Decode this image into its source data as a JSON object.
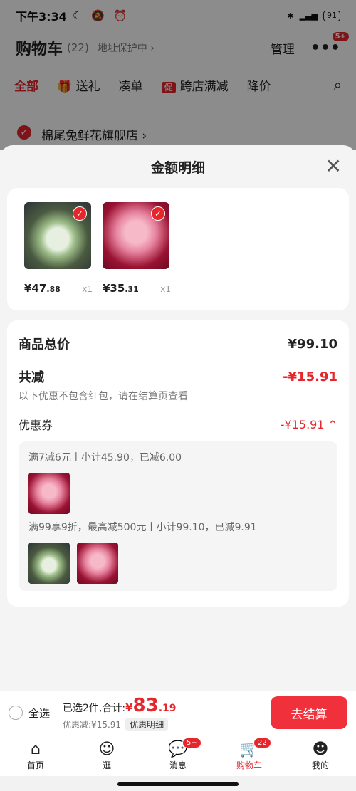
{
  "status_bar": {
    "time": "下午3:34",
    "battery": "91"
  },
  "cart_header": {
    "title": "购物车",
    "count": "(22)",
    "address_protect": "地址保护中 ›",
    "manage": "管理",
    "more_badge": "5+"
  },
  "filter_tabs": [
    {
      "label": "全部"
    },
    {
      "label": "送礼"
    },
    {
      "label": "凑单"
    },
    {
      "label": "跨店满减",
      "tag": "促"
    },
    {
      "label": "降价"
    }
  ],
  "store": {
    "name": "棉尾兔鲜花旗舰店 ›"
  },
  "sheet": {
    "title": "金额明细"
  },
  "products": [
    {
      "price_int": "¥47",
      "price_dec": ".88",
      "qty": "x1"
    },
    {
      "price_int": "¥35",
      "price_dec": ".31",
      "qty": "x1"
    }
  ],
  "details": {
    "goods_total_label": "商品总价",
    "goods_total_value": "¥99.10",
    "discount_label": "共减",
    "discount_value": "-¥15.91",
    "discount_note": "以下优惠不包含红包，请在结算页查看",
    "coupon_label": "优惠券",
    "coupon_value": "-¥15.91 ⌃",
    "coupon_rule_1": "满7减6元丨小计45.90，已减6.00",
    "coupon_rule_2": "满99享9折，最高减500元丨小计99.10，已减9.91"
  },
  "checkout": {
    "select_all": "全选",
    "summary_prefix": "已选2件,合计:",
    "currency": "¥",
    "total_int": "83",
    "total_dec": ".19",
    "discount_small": "优惠减:¥15.91",
    "detail_link": "优惠明细",
    "checkout_button": "去结算"
  },
  "tabbar": [
    {
      "label": "首页",
      "icon": "home-icon"
    },
    {
      "label": "逛",
      "icon": "explore-icon"
    },
    {
      "label": "消息",
      "icon": "message-icon",
      "badge": "5+"
    },
    {
      "label": "购物车",
      "icon": "cart-icon",
      "badge": "22"
    },
    {
      "label": "我的",
      "icon": "profile-icon"
    }
  ],
  "colors": {
    "accent": "#e5262b",
    "checkout_button": "#f0303a"
  }
}
